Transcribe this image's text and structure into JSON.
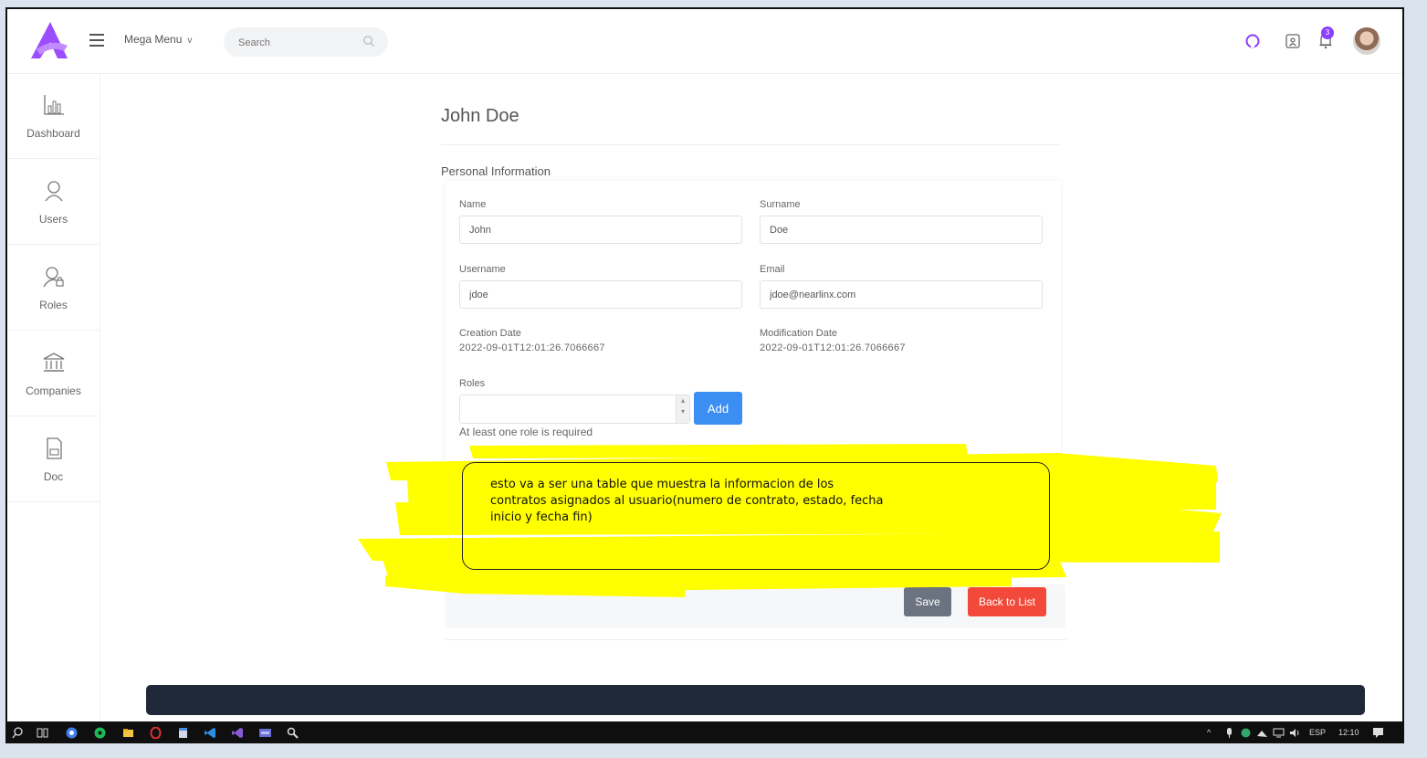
{
  "topbar": {
    "mega_menu_label": "Mega Menu",
    "search_placeholder": "Search",
    "notification_count": "3"
  },
  "sidebar": {
    "items": [
      {
        "label": "Dashboard"
      },
      {
        "label": "Users"
      },
      {
        "label": "Roles"
      },
      {
        "label": "Companies"
      },
      {
        "label": "Doc"
      }
    ]
  },
  "page": {
    "title": "John Doe",
    "section_title": "Personal Information"
  },
  "form": {
    "name_label": "Name",
    "name_value": "John",
    "surname_label": "Surname",
    "surname_value": "Doe",
    "username_label": "Username",
    "username_value": "jdoe",
    "email_label": "Email",
    "email_value": "jdoe@nearlinx.com",
    "creation_label": "Creation Date",
    "creation_value": "2022-09-01T12:01:26.7066667",
    "modification_label": "Modification Date",
    "modification_value": "2022-09-01T12:01:26.7066667",
    "roles_label": "Roles",
    "add_label": "Add",
    "roles_error": "At least one role is required"
  },
  "actions": {
    "save_label": "Save",
    "back_label": "Back to List"
  },
  "annotation": {
    "text": "esto va a ser una table que muestra la informacion de los contratos asignados al usuario(numero de contrato, estado, fecha inicio y fecha fin)"
  },
  "taskbar": {
    "language": "ESP",
    "time": "12:10"
  },
  "colors": {
    "accent": "#8a3ffc",
    "primary_button": "#3b8ff2",
    "save_button": "#6b7380",
    "back_button": "#f2493b",
    "highlighter": "#ffff00"
  }
}
